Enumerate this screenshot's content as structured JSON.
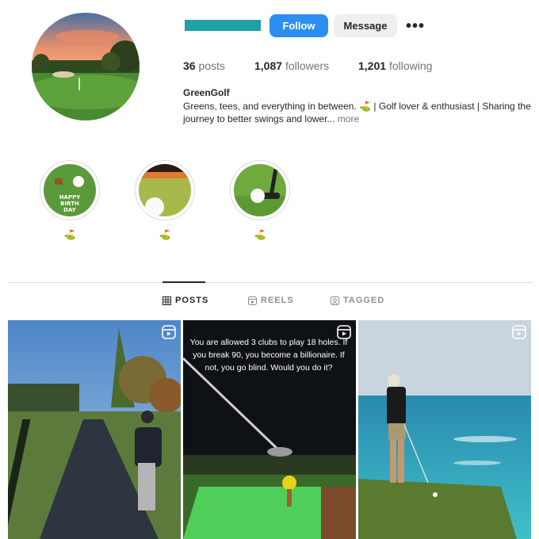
{
  "profile": {
    "follow_label": "Follow",
    "message_label": "Message",
    "posts_count": "36",
    "posts_label": "posts",
    "followers_count": "1,087",
    "followers_label": "followers",
    "following_count": "1,201",
    "following_label": "following",
    "name": "GreenGolf",
    "bio": "Greens, tees, and everything in between. ⛳ | Golf lover & enthusiast | Sharing the journey to better swings and lower...",
    "bio_more": "more"
  },
  "highlights": [
    {
      "label": "⛳"
    },
    {
      "label": "⛳"
    },
    {
      "label": "⛳"
    }
  ],
  "tabs": [
    {
      "label": "POSTS"
    },
    {
      "label": "REELS"
    },
    {
      "label": "TAGGED"
    }
  ],
  "posts": [
    {
      "caption": ""
    },
    {
      "caption": "You are allowed 3 clubs to play 18 holes. If you break 90, you become a billionaire. If not, you go blind. Would you do it?"
    },
    {
      "caption": ""
    }
  ],
  "colors": {
    "accent": "#2b8ff2",
    "username_bar": "#1ea0a6"
  }
}
